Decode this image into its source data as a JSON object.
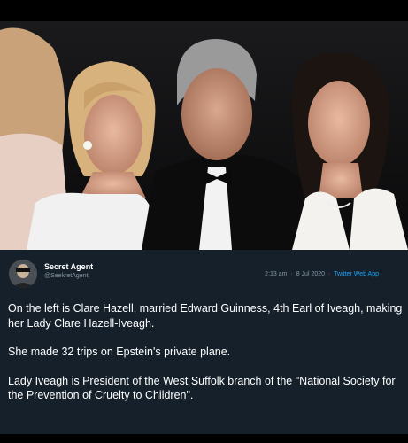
{
  "tweet": {
    "display_name": "Secret Agent",
    "handle": "@SeekretAgent",
    "time": "2:13 am",
    "date": "8 Jul 2020",
    "source": "Twitter Web App",
    "separator": "·",
    "paragraphs": [
      "On the left is Clare Hazell, married Edward Guinness, 4th Earl of Iveagh, making her Lady Clare Hazell-Iveagh.",
      "She made 32 trips on Epstein's private plane.",
      "Lady Iveagh is President of the West Suffolk branch of the \"National Society for the Prevention of Cruelty to Children\"."
    ]
  },
  "colors": {
    "tweet_background": "#15202b",
    "text": "#ffffff",
    "secondary_text": "#8899a6",
    "link": "#1da1f2"
  }
}
